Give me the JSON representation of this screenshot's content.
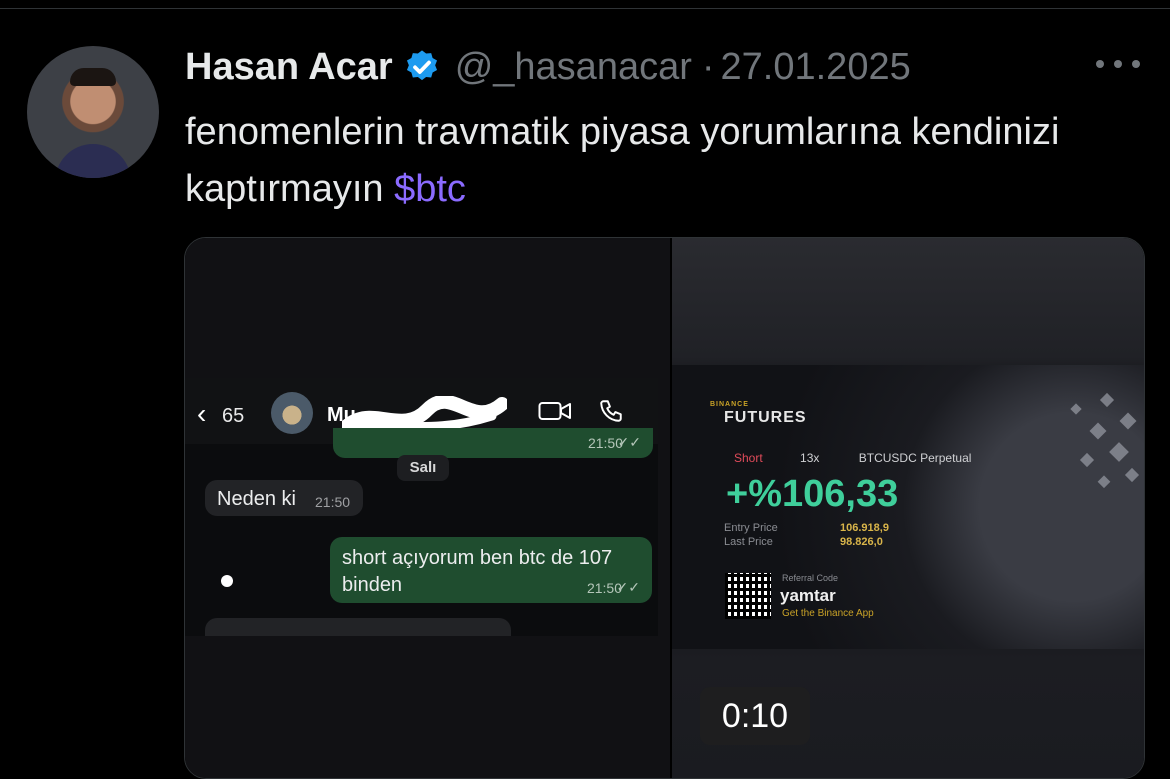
{
  "tweet": {
    "author_name": "Hasan Acar",
    "handle": "@_hasanacar",
    "separator": "·",
    "date": "27.01.2025",
    "text": "fenomenlerin travmatik piyasa yorumlarına kendinizi kaptırmayın",
    "cashtag": "$btc",
    "verified": true,
    "more_icon": "more-horizontal-icon"
  },
  "colors": {
    "background": "#000000",
    "text": "#e7e9ea",
    "muted": "#71767b",
    "cashtag": "#8b6bff",
    "verified": "#1d9bf0"
  },
  "media": {
    "chat": {
      "back_count": "65",
      "contact_name": "Mu",
      "first_time": "21:50",
      "day_label": "Salı",
      "incoming_message": "Neden ki",
      "incoming_time": "21:50",
      "outgoing_message": "short açıyorum ben btc de 107 binden",
      "outgoing_time": "21:50"
    },
    "binance": {
      "brand": "BINANCE",
      "product": "FUTURES",
      "side": "Short",
      "leverage": "13x",
      "pair": "BTCUSDC Perpetual",
      "pnl": "+%106,33",
      "entry_label": "Entry Price",
      "entry_value": "106.918,9",
      "last_label": "Last Price",
      "last_value": "98.826,0",
      "referral_label": "Referral Code",
      "referral_code": "yamtar",
      "referral_sub": "Get the Binance App"
    },
    "video_duration": "0:10"
  }
}
